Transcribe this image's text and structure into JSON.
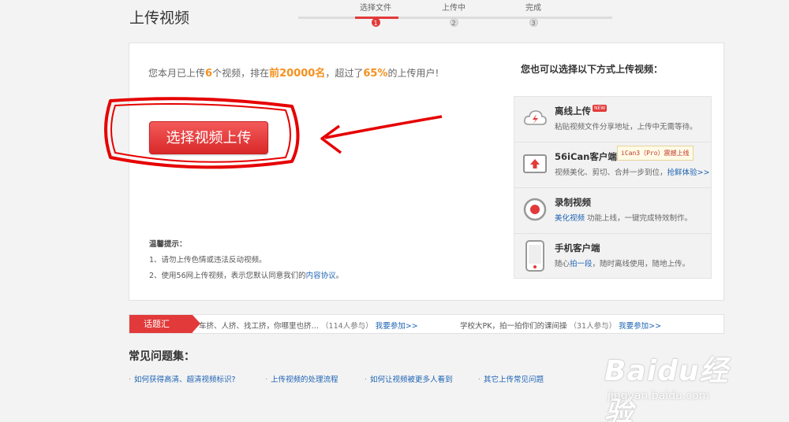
{
  "header": {
    "title": "上传视频"
  },
  "steps": [
    {
      "label": "选择文件",
      "num": "1"
    },
    {
      "label": "上传中",
      "num": "2"
    },
    {
      "label": "完成",
      "num": "3"
    }
  ],
  "stat": {
    "t1": "您本月已上传",
    "count": "6",
    "t2": "个视频，排在",
    "rank": "前20000名",
    "t3": "，超过了",
    "pct": "65%",
    "t4": "的上传用户!"
  },
  "upload_button": "选择视频上传",
  "tips": {
    "title": "温馨提示：",
    "item1": "1、请勿上传色情或违法反动视频。",
    "item2_pre": "2、使用56网上传视频，表示您默认同意我们的",
    "item2_link": "内容协议",
    "item2_post": "。"
  },
  "alt": {
    "title": "您也可以选择以下方式上传视频：",
    "items": [
      {
        "name": "离线上传",
        "badge": "NEW",
        "desc": "粘贴视频文件分享地址，上传中无需等待。",
        "icon": "cloud-upload-icon"
      },
      {
        "name": "56iCan客户端",
        "desc_pre": "视频美化、剪切、合并一步到位，",
        "link": "抢鲜体验>>",
        "tooltip": "iCan3（Pro）震撼上线",
        "icon": "upload-arrow-icon"
      },
      {
        "name": "录制视频",
        "link": "美化视频",
        "desc_post": " 功能上线，一键完成特效制作。",
        "icon": "record-icon"
      },
      {
        "name": "手机客户端",
        "desc_pre": "随心",
        "link": "拍一段",
        "desc_post": "，随时离线使用，随地上传。",
        "icon": "phone-icon"
      }
    ]
  },
  "topic_bar": {
    "label": "话题汇",
    "topics": [
      {
        "text": "车挤、人挤、找工挤，你哪里也挤…",
        "count": "（114人参与）",
        "join": "我要参加>>"
      },
      {
        "text": "学校大PK，拍一拍你们的课间操",
        "count": "（31人参与）",
        "join": "我要参加>>"
      }
    ]
  },
  "faq": {
    "title": "常见问题集：",
    "items": [
      "如何获得高清、超清视频标识?",
      "上传视频的处理流程",
      "如何让视频被更多人看到",
      "其它上传常见问题"
    ]
  },
  "watermark": {
    "main": "Baidu经验",
    "sub": "jingyan.baidu.com"
  },
  "colors": {
    "accent": "#e23a3a",
    "link": "#1e64b4",
    "highlight": "#f5901e"
  }
}
